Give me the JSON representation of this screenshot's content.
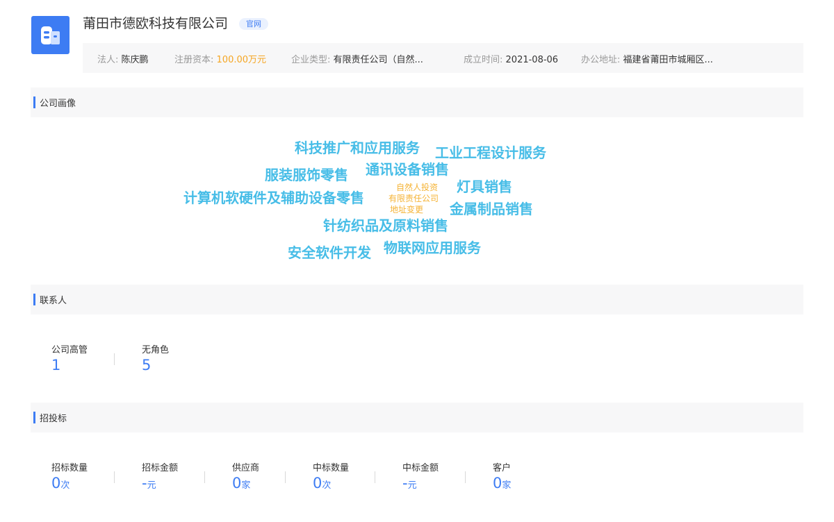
{
  "company": {
    "name": "莆田市德欧科技有限公司",
    "official_tag": "官网",
    "logo_icon": "building-icon",
    "logo_color": "#3d7cf3"
  },
  "info": [
    {
      "label": "法人:",
      "value": "陈庆鹏"
    },
    {
      "label": "注册资本:",
      "value": "100.00万元"
    },
    {
      "label": "企业类型:",
      "value": "有限责任公司（自然..."
    },
    {
      "label": "成立时间:",
      "value": "2021-08-06"
    },
    {
      "label": "办公地址:",
      "value": "福建省莆田市城厢区..."
    }
  ],
  "sections": {
    "portrait": "公司画像",
    "contacts": "联系人",
    "bidding": "招投标"
  },
  "word_cloud": [
    {
      "text": "科技推广和应用服务",
      "size": "big"
    },
    {
      "text": "工业工程设计服务",
      "size": "big"
    },
    {
      "text": "服装服饰零售",
      "size": "big"
    },
    {
      "text": "通讯设备销售",
      "size": "big"
    },
    {
      "text": "计算机软硬件及辅助设备零售",
      "size": "big"
    },
    {
      "text": "自然人投资",
      "size": "small"
    },
    {
      "text": "有限责任公司",
      "size": "small"
    },
    {
      "text": "地址变更",
      "size": "small"
    },
    {
      "text": "灯具销售",
      "size": "big"
    },
    {
      "text": "金属制品销售",
      "size": "big"
    },
    {
      "text": "针纺织品及原料销售",
      "size": "big"
    },
    {
      "text": "安全软件开发",
      "size": "big"
    },
    {
      "text": "物联网应用服务",
      "size": "big"
    }
  ],
  "contacts": [
    {
      "label": "公司高管",
      "value": "1",
      "unit": ""
    },
    {
      "label": "无角色",
      "value": "5",
      "unit": ""
    }
  ],
  "bidding": [
    {
      "label": "招标数量",
      "value": "0",
      "unit": "次"
    },
    {
      "label": "招标金额",
      "value": "-",
      "unit": "元"
    },
    {
      "label": "供应商",
      "value": "0",
      "unit": "家"
    },
    {
      "label": "中标数量",
      "value": "0",
      "unit": "次"
    },
    {
      "label": "中标金额",
      "value": "-",
      "unit": "元"
    },
    {
      "label": "客户",
      "value": "0",
      "unit": "家"
    }
  ]
}
